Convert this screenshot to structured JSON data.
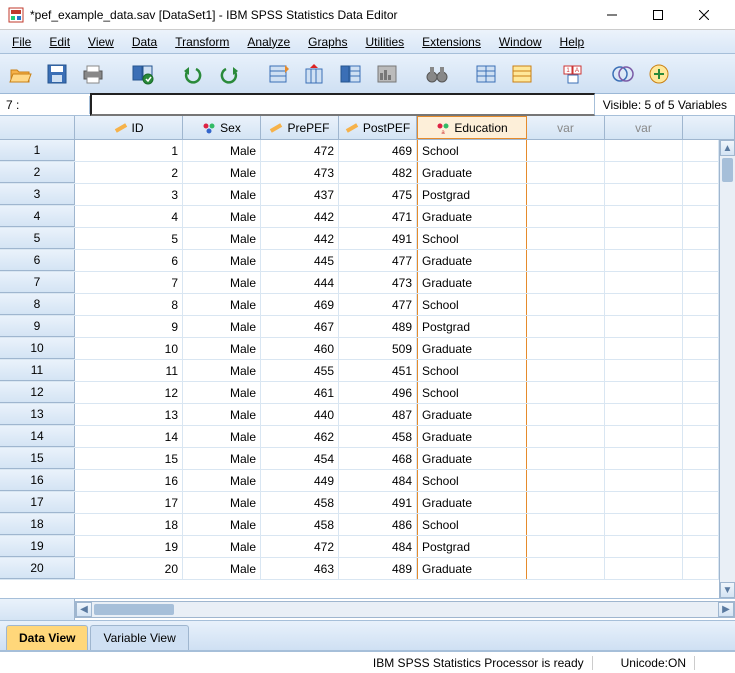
{
  "window": {
    "title": "*pef_example_data.sav [DataSet1] - IBM SPSS Statistics Data Editor"
  },
  "menu": {
    "file": "File",
    "edit": "Edit",
    "view": "View",
    "data": "Data",
    "transform": "Transform",
    "analyze": "Analyze",
    "graphs": "Graphs",
    "utilities": "Utilities",
    "extensions": "Extensions",
    "window": "Window",
    "help": "Help"
  },
  "info": {
    "cell_ref": "7 :",
    "cell_val": "",
    "visible": "Visible: 5 of 5 Variables"
  },
  "columns": {
    "id": "ID",
    "sex": "Sex",
    "pre": "PrePEF",
    "post": "PostPEF",
    "edu": "Education",
    "var": "var"
  },
  "rows": [
    {
      "n": "1",
      "id": "1",
      "sex": "Male",
      "pre": "472",
      "post": "469",
      "edu": "School"
    },
    {
      "n": "2",
      "id": "2",
      "sex": "Male",
      "pre": "473",
      "post": "482",
      "edu": "Graduate"
    },
    {
      "n": "3",
      "id": "3",
      "sex": "Male",
      "pre": "437",
      "post": "475",
      "edu": "Postgrad"
    },
    {
      "n": "4",
      "id": "4",
      "sex": "Male",
      "pre": "442",
      "post": "471",
      "edu": "Graduate"
    },
    {
      "n": "5",
      "id": "5",
      "sex": "Male",
      "pre": "442",
      "post": "491",
      "edu": "School"
    },
    {
      "n": "6",
      "id": "6",
      "sex": "Male",
      "pre": "445",
      "post": "477",
      "edu": "Graduate"
    },
    {
      "n": "7",
      "id": "7",
      "sex": "Male",
      "pre": "444",
      "post": "473",
      "edu": "Graduate"
    },
    {
      "n": "8",
      "id": "8",
      "sex": "Male",
      "pre": "469",
      "post": "477",
      "edu": "School"
    },
    {
      "n": "9",
      "id": "9",
      "sex": "Male",
      "pre": "467",
      "post": "489",
      "edu": "Postgrad"
    },
    {
      "n": "10",
      "id": "10",
      "sex": "Male",
      "pre": "460",
      "post": "509",
      "edu": "Graduate"
    },
    {
      "n": "11",
      "id": "11",
      "sex": "Male",
      "pre": "455",
      "post": "451",
      "edu": "School"
    },
    {
      "n": "12",
      "id": "12",
      "sex": "Male",
      "pre": "461",
      "post": "496",
      "edu": "School"
    },
    {
      "n": "13",
      "id": "13",
      "sex": "Male",
      "pre": "440",
      "post": "487",
      "edu": "Graduate"
    },
    {
      "n": "14",
      "id": "14",
      "sex": "Male",
      "pre": "462",
      "post": "458",
      "edu": "Graduate"
    },
    {
      "n": "15",
      "id": "15",
      "sex": "Male",
      "pre": "454",
      "post": "468",
      "edu": "Graduate"
    },
    {
      "n": "16",
      "id": "16",
      "sex": "Male",
      "pre": "449",
      "post": "484",
      "edu": "School"
    },
    {
      "n": "17",
      "id": "17",
      "sex": "Male",
      "pre": "458",
      "post": "491",
      "edu": "Graduate"
    },
    {
      "n": "18",
      "id": "18",
      "sex": "Male",
      "pre": "458",
      "post": "486",
      "edu": "School"
    },
    {
      "n": "19",
      "id": "19",
      "sex": "Male",
      "pre": "472",
      "post": "484",
      "edu": "Postgrad"
    },
    {
      "n": "20",
      "id": "20",
      "sex": "Male",
      "pre": "463",
      "post": "489",
      "edu": "Graduate"
    }
  ],
  "tabs": {
    "data": "Data View",
    "variable": "Variable View"
  },
  "status": {
    "processor": "IBM SPSS Statistics Processor is ready",
    "unicode": "Unicode:ON"
  }
}
